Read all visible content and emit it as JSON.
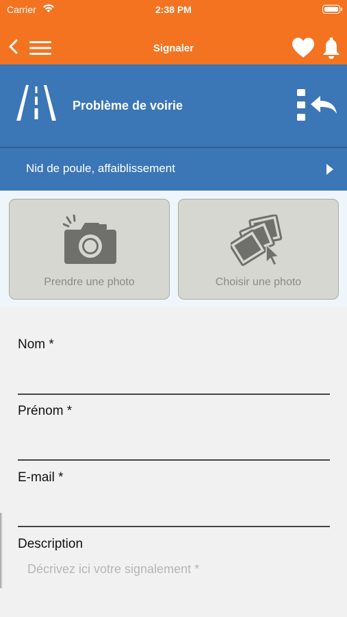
{
  "status_bar": {
    "carrier": "Carrier",
    "time": "2:38 PM"
  },
  "nav": {
    "title": "Signaler",
    "icons": [
      "chevron-left-icon",
      "hamburger-menu-icon",
      "heart-icon",
      "bell-icon"
    ]
  },
  "category": {
    "label": "Problème de voirie",
    "icon": "road-icon",
    "switch_icon": "change-category-icon"
  },
  "subcategory": {
    "label": "Nid de poule, affaiblissement",
    "icon": "chevron-right-icon"
  },
  "photos": {
    "take_label": "Prendre une photo",
    "choose_label": "Choisir une photo"
  },
  "form": {
    "nom_label": "Nom *",
    "prenom_label": "Prénom *",
    "email_label": "E-mail *",
    "description_label": "Description",
    "description_placeholder": "Décrivez ici votre signalement *"
  },
  "colors": {
    "nav_orange": "#f37321",
    "category_blue": "#3b76b6",
    "photo_button_bg": "#d7d7d2"
  }
}
